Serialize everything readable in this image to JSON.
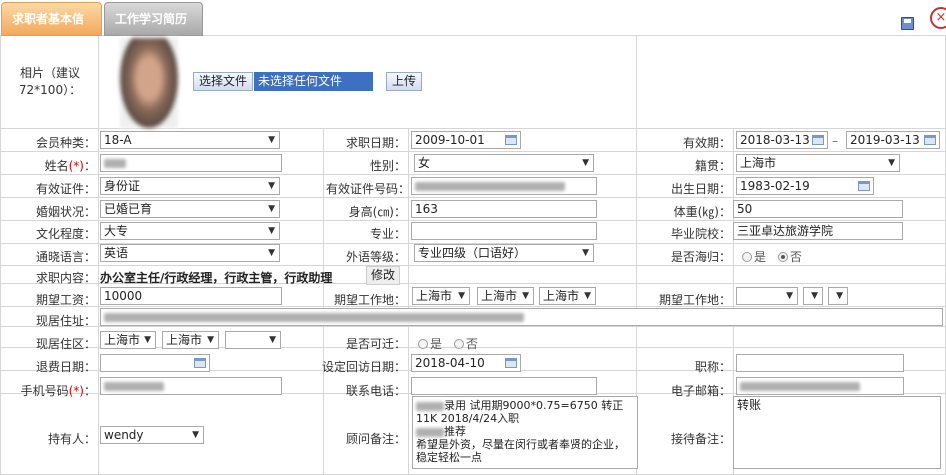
{
  "tabs": [
    {
      "label": "求职者基本信息"
    },
    {
      "label": "工作学习简历"
    }
  ],
  "photo": {
    "label": "相片（建议72*100）：",
    "file_button": "选择文件",
    "file_status": "未选择任何文件",
    "upload_button": "上传"
  },
  "member_type": {
    "label": "会员种类：",
    "value": "18-A"
  },
  "apply_date": {
    "label": "求职日期：",
    "value": "2009-10-01"
  },
  "validity": {
    "label": "有效期：",
    "from": "2018-03-13",
    "sep": "–",
    "to": "2019-03-13"
  },
  "name": {
    "label": "姓名",
    "req": "(*)",
    "colon": "："
  },
  "gender": {
    "label": "性别：",
    "value": "女"
  },
  "native": {
    "label": "籍贯：",
    "value": "上海市"
  },
  "id_type": {
    "label": "有效证件：",
    "value": "身份证"
  },
  "id_no": {
    "label": "有效证件号码："
  },
  "birth": {
    "label": "出生日期：",
    "value": "1983-02-19"
  },
  "marital": {
    "label": "婚姻状况：",
    "value": "已婚已育"
  },
  "height": {
    "label": "身高(㎝)：",
    "value": "163"
  },
  "weight": {
    "label": "体重(㎏)：",
    "value": "50"
  },
  "education": {
    "label": "文化程度：",
    "value": "大专"
  },
  "major": {
    "label": "专业："
  },
  "school": {
    "label": "毕业院校：",
    "value": "三亚卓达旅游学院"
  },
  "language": {
    "label": "通晓语言：",
    "value": "英语"
  },
  "lang_level": {
    "label": "外语等级：",
    "value": "专业四级（口语好）"
  },
  "returnee": {
    "label": "是否海归：",
    "yes": "是",
    "no": "否"
  },
  "job_content": {
    "label": "求职内容：",
    "value": "办公室主任/行政经理，行政主管，行政助理",
    "button": "修改"
  },
  "salary": {
    "label": "期望工资：",
    "value": "10000"
  },
  "work_place1": {
    "label": "期望工作地：",
    "values": [
      "上海市",
      "上海市",
      "上海市"
    ]
  },
  "work_place2": {
    "label": "期望工作地："
  },
  "address": {
    "label": "现居住址："
  },
  "district": {
    "label": "现居住区：",
    "values": [
      "上海市",
      "上海市"
    ]
  },
  "relocate": {
    "label": "是否可迁：",
    "yes": "是",
    "no": "否"
  },
  "refund": {
    "label": "退费日期："
  },
  "revisit": {
    "label": "设定回访日期：",
    "value": "2018-04-10"
  },
  "title": {
    "label": "职称："
  },
  "mobile": {
    "label": "手机号码",
    "req": "(*)",
    "colon": "："
  },
  "phone": {
    "label": "联系电话："
  },
  "email": {
    "label": "电子邮箱："
  },
  "holder": {
    "label": "持有人：",
    "value": "wendy"
  },
  "consultant_note": {
    "label": "顾问备注：",
    "line1": "录用  试用期9000*0.75=6750 转正",
    "line2": "11K   2018/4/24入职",
    "line3": "推荐",
    "line4": "希望是外资，尽量在闵行或者奉贤的企业，稳定轻松一点"
  },
  "reception_note": {
    "label": "接待备注：",
    "value": "转账"
  }
}
